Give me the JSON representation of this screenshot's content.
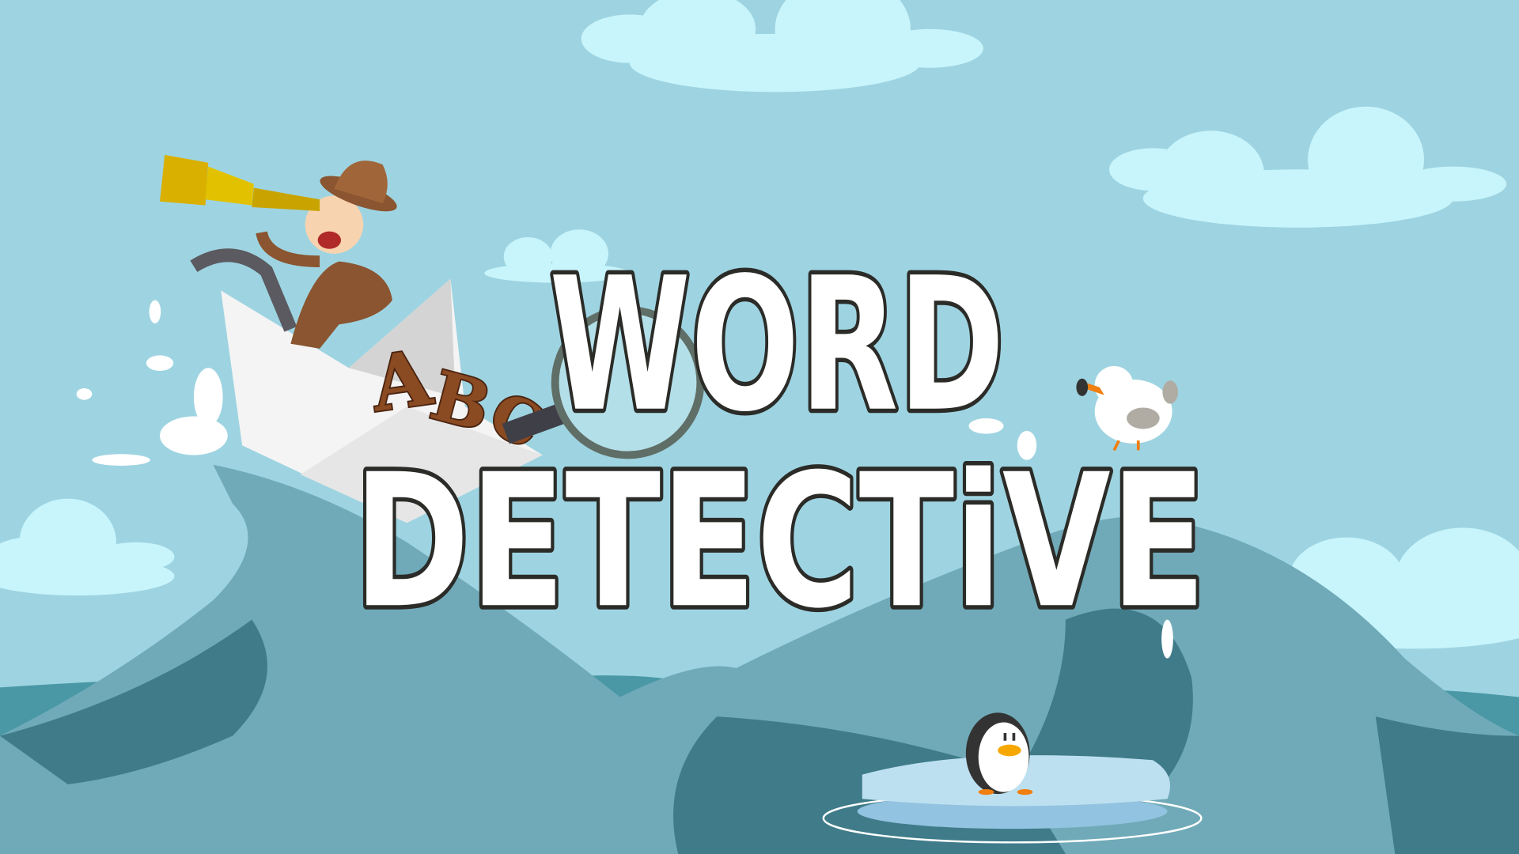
{
  "title": {
    "line1": "WORD",
    "line2": "DETECTiVE"
  },
  "logo_letters": "ABC",
  "colors": {
    "sky": "#9ed4e1",
    "cloud": "#c8f5fc",
    "sea_light": "#70aab8",
    "sea_mid": "#4a98a6",
    "sea_dark": "#3f7b89",
    "title_fill": "#ffffff",
    "title_outline": "#2b2b28",
    "telescope": "#d9b000",
    "ice": "#bde0f0"
  },
  "characters": [
    "detective-explorer",
    "seagull",
    "penguin"
  ]
}
